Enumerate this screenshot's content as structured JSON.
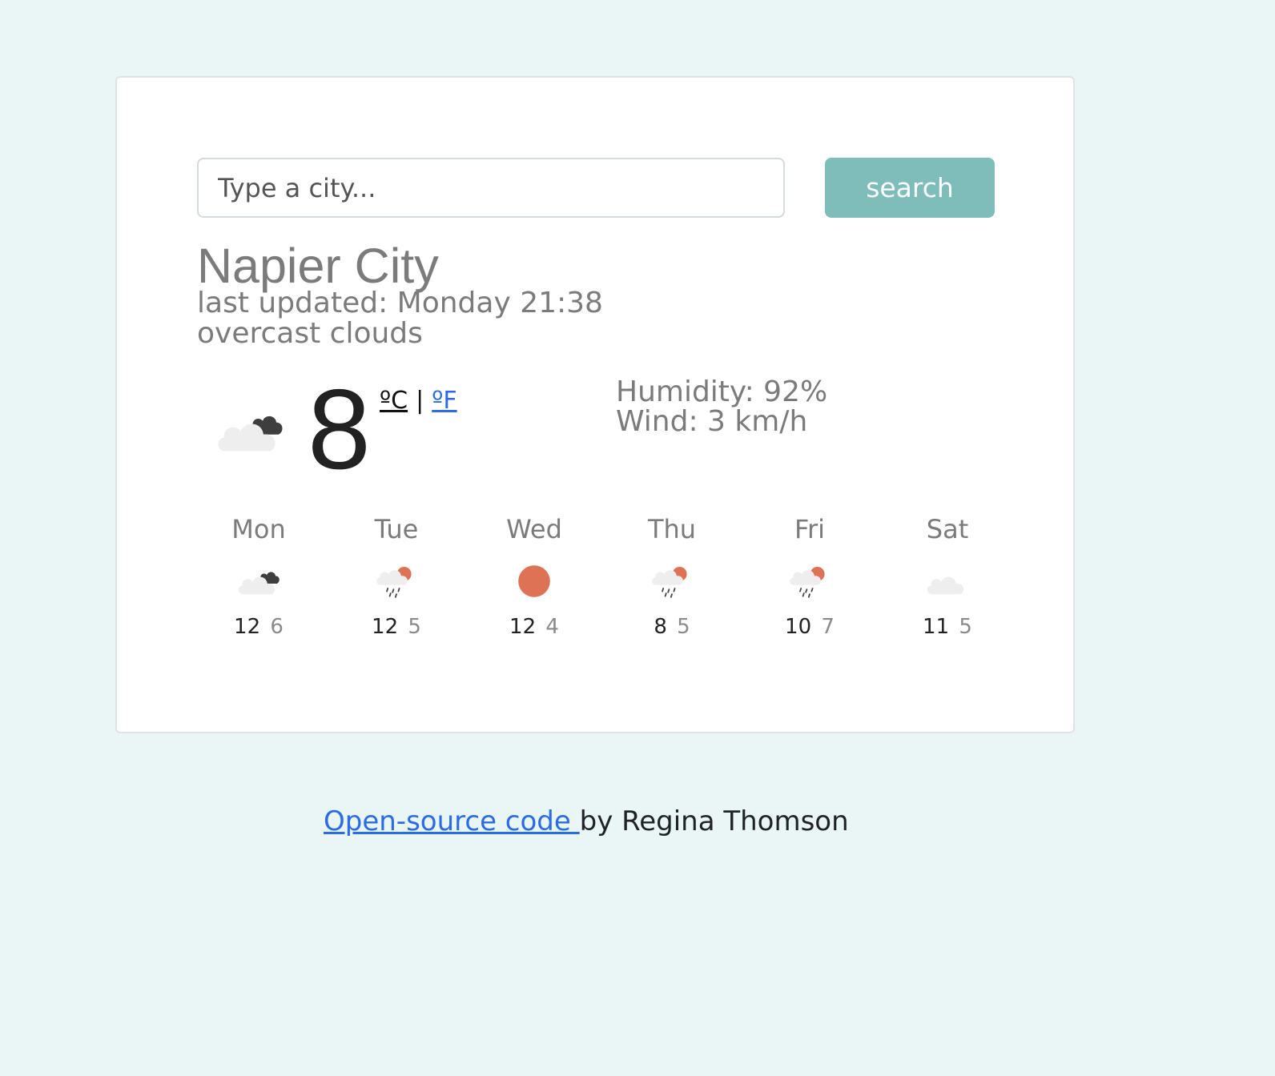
{
  "search": {
    "placeholder": "Type a city...",
    "value": "",
    "button_label": "search"
  },
  "current": {
    "city": "Napier City",
    "last_updated": "last updated: Monday 21:38",
    "description": "overcast clouds",
    "icon": "broken-clouds-icon",
    "temperature": "8",
    "unit_celsius": "ºC",
    "unit_separator": "|",
    "unit_fahrenheit": "ºF",
    "humidity": "Humidity: 92%",
    "wind": "Wind: 3 km/h"
  },
  "forecast": [
    {
      "day": "Mon",
      "icon": "broken-clouds-icon",
      "max": "12",
      "min": "6"
    },
    {
      "day": "Tue",
      "icon": "rain-sun-icon",
      "max": "12",
      "min": "5"
    },
    {
      "day": "Wed",
      "icon": "sun-icon",
      "max": "12",
      "min": "4"
    },
    {
      "day": "Thu",
      "icon": "rain-sun-icon",
      "max": "8",
      "min": "5"
    },
    {
      "day": "Fri",
      "icon": "rain-sun-icon",
      "max": "10",
      "min": "7"
    },
    {
      "day": "Sat",
      "icon": "cloud-icon",
      "max": "11",
      "min": "5"
    }
  ],
  "footer": {
    "link_text": "Open-source code ",
    "suffix": "by Regina Thomson"
  },
  "colors": {
    "page_background": "#eaf5f5",
    "accent": "#7fbdbb",
    "sun": "#de7254",
    "link": "#2a6ce8"
  }
}
